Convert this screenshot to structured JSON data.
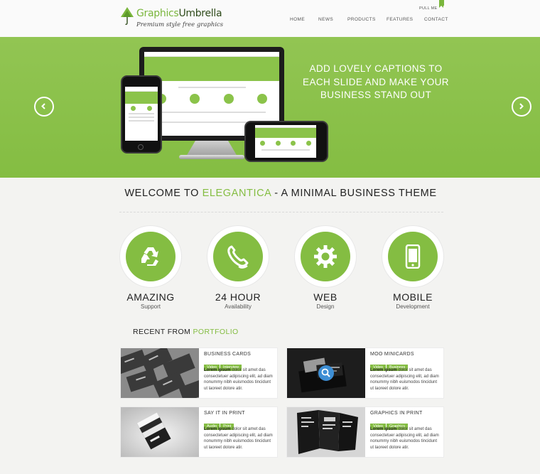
{
  "brand": {
    "name_part1": "Graphics",
    "name_part2": "Umbrella",
    "tagline": "Premium style free graphics"
  },
  "nav": {
    "items": [
      "HOME",
      "NEWS",
      "PRODUCTS",
      "FEATURES",
      "CONTACT"
    ],
    "pull_label": "PULL ME"
  },
  "slider": {
    "caption": "ADD LOVELY CAPTIONS TO EACH SLIDE AND MAKE YOUR BUSINESS STAND OUT",
    "accent": "#84bd42"
  },
  "welcome": {
    "prefix": "WELCOME TO ",
    "highlight": "ELEGANTICA",
    "suffix": " - A MINIMAL BUSINESS THEME"
  },
  "features": [
    {
      "title": "AMAZING",
      "sub": "Support",
      "icon": "recycle-icon"
    },
    {
      "title": "24 HOUR",
      "sub": "Availability",
      "icon": "phone-icon"
    },
    {
      "title": "WEB",
      "sub": "Design",
      "icon": "gear-icon"
    },
    {
      "title": "MOBILE",
      "sub": "Development",
      "icon": "mobile-icon"
    }
  ],
  "portfolio": {
    "heading_prefix": "RECENT FROM ",
    "heading_highlight": "PORTFOLIO",
    "items": [
      {
        "title": "BUSINESS CARDS",
        "tags": [
          "Video",
          "Interview"
        ],
        "lead": "Lorem ipsum",
        "text": " dolor sit amet das consectetuer adipiscing elit, ad diam nonummy nibh euismodos tincidunt ut laoreet dolore atir."
      },
      {
        "title": "MOO MINICARDS",
        "tags": [
          "Video",
          "Business"
        ],
        "lead": "Lorem ipsum",
        "text": " dolor sit amet das consectetuer adipiscing elit, ad diam nonummy nibh euismodos tincidunt ut laoreet dolore atir."
      },
      {
        "title": "SAY IT IN PRINT",
        "tags": [
          "Audio",
          "Print"
        ],
        "lead": "Lorem ipsum",
        "text": " dolor sit amet das consectetuer adipiscing elit, ad diam nonummy nibh euismodos tincidunt ut laoreet dolore atir."
      },
      {
        "title": "GRAPHICS IN PRINT",
        "tags": [
          "Video",
          "Graphics"
        ],
        "lead": "Lorem ipsum",
        "text": " dolor sit amet das consectetuer adipiscing elit, ad diam nonummy nibh euismodos tincidunt ut laoreet dolore atir."
      }
    ]
  }
}
